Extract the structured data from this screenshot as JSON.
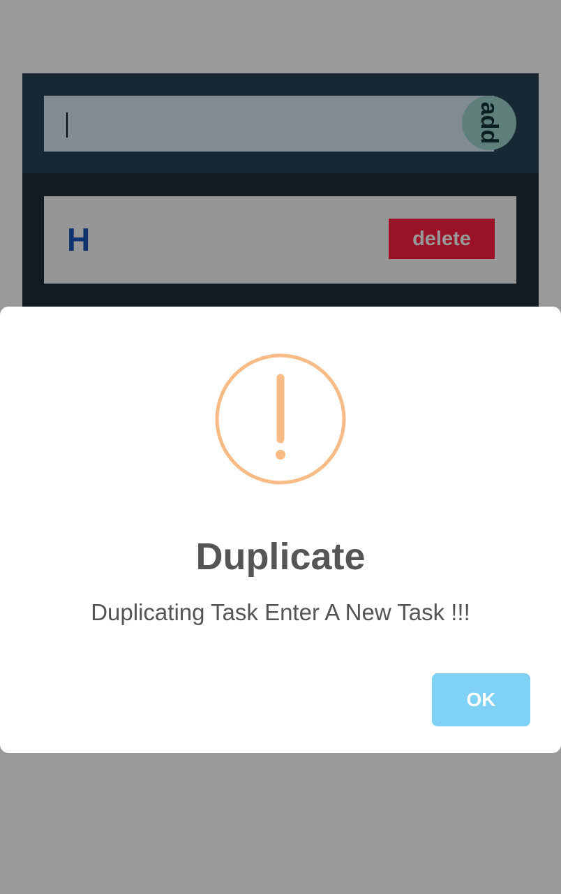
{
  "task_input": {
    "value": "",
    "add_label": "add"
  },
  "tasks": [
    {
      "text": "H",
      "delete_label": "delete"
    }
  ],
  "modal": {
    "icon": "warning-icon",
    "title": "Duplicate",
    "message": "Duplicating Task Enter A New Task !!!",
    "ok_label": "OK"
  },
  "colors": {
    "card_background": "#1f2d3a",
    "input_row_background": "#274458",
    "add_button": "#9fd6cc",
    "delete_button": "#ff1e3f",
    "task_text": "#1a56b8",
    "warning_icon": "#f8bb86",
    "ok_button": "#7fd1f5",
    "overlay": "rgba(0,0,0,0.4)"
  }
}
